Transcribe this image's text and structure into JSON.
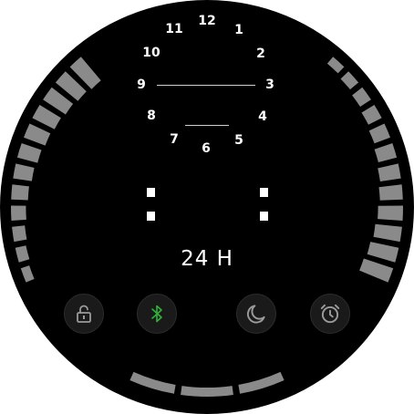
{
  "dial": {
    "numbers": [
      "12",
      "1",
      "2",
      "3",
      "4",
      "5",
      "6",
      "7",
      "8",
      "9",
      "10",
      "11"
    ]
  },
  "time_format_label": "24 H",
  "buttons": [
    {
      "name": "lock-button",
      "icon": "lock-icon",
      "color": "#9a9a9a",
      "active": false
    },
    {
      "name": "bluetooth-button",
      "icon": "bluetooth-icon",
      "color": "#2fb33a",
      "active": true
    },
    {
      "name": "night-mode-button",
      "icon": "moon-icon",
      "color": "#9a9a9a",
      "active": false
    },
    {
      "name": "alarm-button",
      "icon": "alarm-clock-icon",
      "color": "#9a9a9a",
      "active": false
    }
  ],
  "colors": {
    "background": "#000000",
    "text": "#ffffff",
    "level_bar": "#8a8a8a",
    "accent_active": "#2fb33a",
    "button_inactive": "#9a9a9a"
  },
  "left_gauge": {
    "segments": 12
  },
  "right_gauge": {
    "segments": 12
  },
  "bottom_gauge": {
    "segments": 3
  }
}
